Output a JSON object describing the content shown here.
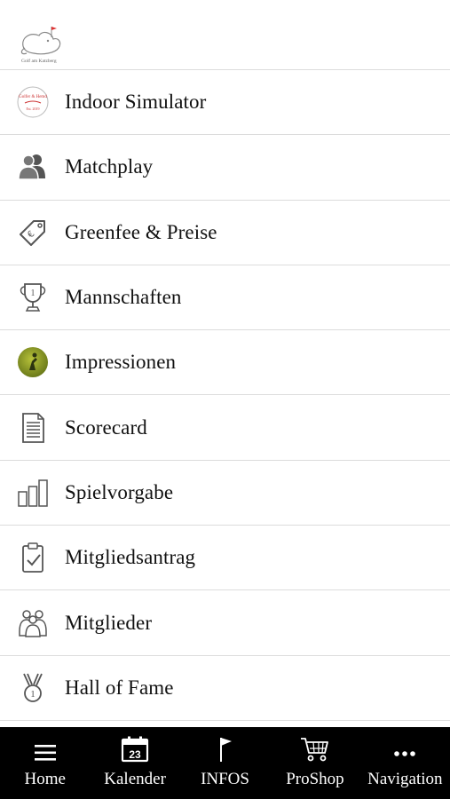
{
  "header": {
    "logo_icon": "club-logo-cat-icon",
    "logo_text": "Golf am Katzberg"
  },
  "menu": [
    {
      "label": "Indoor Simulator",
      "icon": "indoor-simulator-logo-icon",
      "logo_text": "Indoor Golf Est. 2019"
    },
    {
      "label": "Matchplay",
      "icon": "people-icon"
    },
    {
      "label": "Greenfee & Preise",
      "icon": "price-tag-icon"
    },
    {
      "label": "Mannschaften",
      "icon": "trophy-icon"
    },
    {
      "label": "Impressionen",
      "icon": "golfer-photo-icon"
    },
    {
      "label": "Scorecard",
      "icon": "document-icon"
    },
    {
      "label": "Spielvorgabe",
      "icon": "bar-chart-icon"
    },
    {
      "label": "Mitgliedsantrag",
      "icon": "clipboard-check-icon"
    },
    {
      "label": "Mitglieder",
      "icon": "members-icon"
    },
    {
      "label": "Hall of Fame",
      "icon": "medal-icon"
    }
  ],
  "tabbar": {
    "items": [
      {
        "label": "Home",
        "icon": "hamburger-icon"
      },
      {
        "label": "Kalender",
        "icon": "calendar-icon",
        "calendar_day": "23"
      },
      {
        "label": "INFOS",
        "icon": "flag-icon"
      },
      {
        "label": "ProShop",
        "icon": "shopping-cart-icon"
      },
      {
        "label": "Navigation",
        "icon": "more-dots-icon"
      }
    ]
  },
  "colors": {
    "background": "#ffffff",
    "divider": "#dcdcdc",
    "text": "#111111",
    "tabbar_bg": "#000000",
    "tabbar_text": "#ffffff",
    "icon_gray": "#555555"
  }
}
